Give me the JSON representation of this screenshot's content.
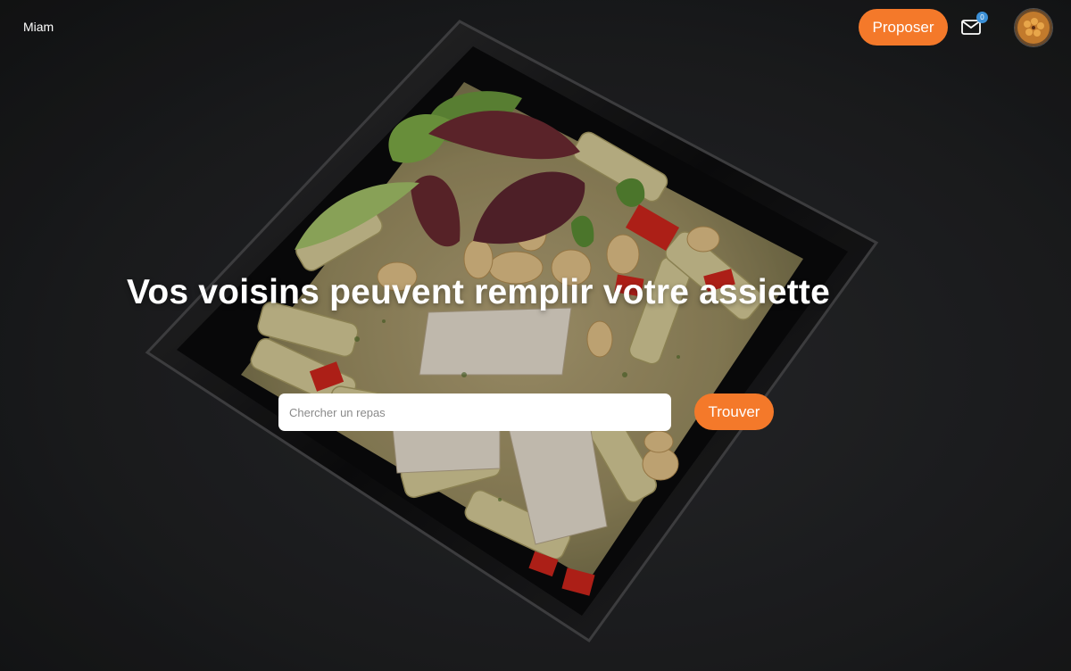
{
  "nav": {
    "brand": "Miam",
    "propose_label": "Proposer",
    "mail_icon": "mail-icon",
    "unread_count": "0",
    "avatar_icon": "user-avatar"
  },
  "hero": {
    "headline": "Vos voisins peuvent remplir votre assiette",
    "background_image": "pasta-salad-box-on-slate"
  },
  "search": {
    "placeholder": "Chercher un repas",
    "value": "",
    "submit_label": "Trouver"
  },
  "colors": {
    "accent": "#f4792a",
    "badge": "#3b8fd6",
    "text_on_dark": "#ffffff"
  }
}
